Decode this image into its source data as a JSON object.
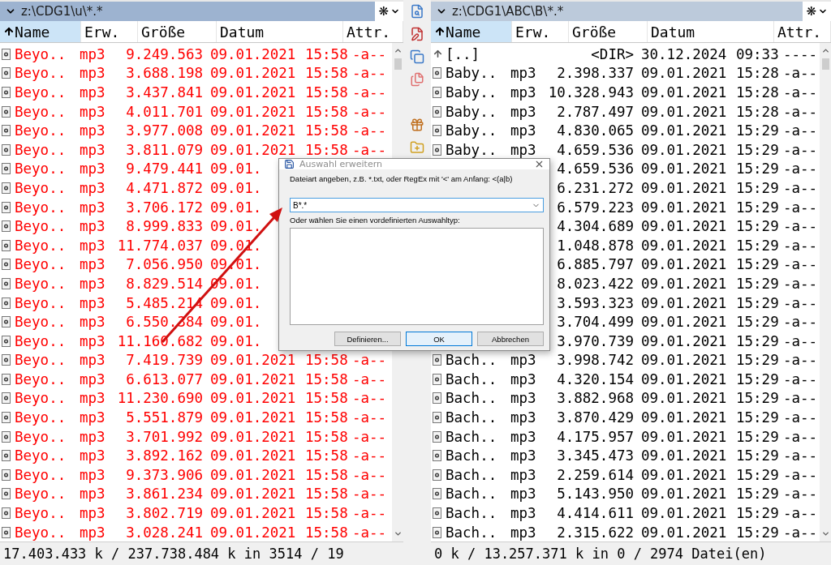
{
  "panels": [
    {
      "path": "z:\\CDG1\\u\\*.*",
      "active": true,
      "menu_glyph": "❋",
      "columns": [
        {
          "label": "Name",
          "selected": true
        },
        {
          "label": "Erw.",
          "selected": false
        },
        {
          "label": "Größe",
          "selected": false
        },
        {
          "label": "Datum",
          "selected": false
        },
        {
          "label": "Attr.",
          "selected": false
        }
      ],
      "rows": [
        {
          "kind": "file",
          "selected": true,
          "name": "Beyo..",
          "ext": "mp3",
          "size": "9.249.563",
          "date": "09.01.2021",
          "time": "15:58",
          "attr": "-a--"
        },
        {
          "kind": "file",
          "selected": true,
          "name": "Beyo..",
          "ext": "mp3",
          "size": "3.688.198",
          "date": "09.01.2021",
          "time": "15:58",
          "attr": "-a--"
        },
        {
          "kind": "file",
          "selected": true,
          "name": "Beyo..",
          "ext": "mp3",
          "size": "3.437.841",
          "date": "09.01.2021",
          "time": "15:58",
          "attr": "-a--"
        },
        {
          "kind": "file",
          "selected": true,
          "name": "Beyo..",
          "ext": "mp3",
          "size": "4.011.701",
          "date": "09.01.2021",
          "time": "15:58",
          "attr": "-a--"
        },
        {
          "kind": "file",
          "selected": true,
          "name": "Beyo..",
          "ext": "mp3",
          "size": "3.977.008",
          "date": "09.01.2021",
          "time": "15:58",
          "attr": "-a--"
        },
        {
          "kind": "file",
          "selected": true,
          "name": "Beyo..",
          "ext": "mp3",
          "size": "3.811.079",
          "date": "09.01.2021",
          "time": "15:58",
          "attr": "-a--"
        },
        {
          "kind": "file",
          "selected": true,
          "name": "Beyo..",
          "ext": "mp3",
          "size": "9.479.441",
          "date": "09.01."
        },
        {
          "kind": "file",
          "selected": true,
          "name": "Beyo..",
          "ext": "mp3",
          "size": "4.471.872",
          "date": "09.01."
        },
        {
          "kind": "file",
          "selected": true,
          "name": "Beyo..",
          "ext": "mp3",
          "size": "3.706.172",
          "date": "09.01."
        },
        {
          "kind": "file",
          "selected": true,
          "name": "Beyo..",
          "ext": "mp3",
          "size": "8.999.833",
          "date": "09.01."
        },
        {
          "kind": "file",
          "selected": true,
          "name": "Beyo..",
          "ext": "mp3",
          "size": "11.774.037",
          "date": "09.01."
        },
        {
          "kind": "file",
          "selected": true,
          "name": "Beyo..",
          "ext": "mp3",
          "size": "7.056.950",
          "date": "09.01."
        },
        {
          "kind": "file",
          "selected": true,
          "name": "Beyo..",
          "ext": "mp3",
          "size": "8.829.514",
          "date": "09.01."
        },
        {
          "kind": "file",
          "selected": true,
          "name": "Beyo..",
          "ext": "mp3",
          "size": "5.485.214",
          "date": "09.01."
        },
        {
          "kind": "file",
          "selected": true,
          "name": "Beyo..",
          "ext": "mp3",
          "size": "6.550.384",
          "date": "09.01."
        },
        {
          "kind": "file",
          "selected": true,
          "name": "Beyo..",
          "ext": "mp3",
          "size": "11.160.682",
          "date": "09.01."
        },
        {
          "kind": "file",
          "selected": true,
          "name": "Beyo..",
          "ext": "mp3",
          "size": "7.419.739",
          "date": "09.01.2021",
          "time": "15:58",
          "attr": "-a--"
        },
        {
          "kind": "file",
          "selected": true,
          "name": "Beyo..",
          "ext": "mp3",
          "size": "6.613.077",
          "date": "09.01.2021",
          "time": "15:58",
          "attr": "-a--"
        },
        {
          "kind": "file",
          "selected": true,
          "name": "Beyo..",
          "ext": "mp3",
          "size": "11.230.690",
          "date": "09.01.2021",
          "time": "15:58",
          "attr": "-a--"
        },
        {
          "kind": "file",
          "selected": true,
          "name": "Beyo..",
          "ext": "mp3",
          "size": "5.551.879",
          "date": "09.01.2021",
          "time": "15:58",
          "attr": "-a--"
        },
        {
          "kind": "file",
          "selected": true,
          "name": "Beyo..",
          "ext": "mp3",
          "size": "3.701.992",
          "date": "09.01.2021",
          "time": "15:58",
          "attr": "-a--"
        },
        {
          "kind": "file",
          "selected": true,
          "name": "Beyo..",
          "ext": "mp3",
          "size": "3.892.162",
          "date": "09.01.2021",
          "time": "15:58",
          "attr": "-a--"
        },
        {
          "kind": "file",
          "selected": true,
          "name": "Beyo..",
          "ext": "mp3",
          "size": "9.373.906",
          "date": "09.01.2021",
          "time": "15:58",
          "attr": "-a--"
        },
        {
          "kind": "file",
          "selected": true,
          "name": "Beyo..",
          "ext": "mp3",
          "size": "3.861.234",
          "date": "09.01.2021",
          "time": "15:58",
          "attr": "-a--"
        },
        {
          "kind": "file",
          "selected": true,
          "name": "Beyo..",
          "ext": "mp3",
          "size": "3.802.719",
          "date": "09.01.2021",
          "time": "15:58",
          "attr": "-a--"
        },
        {
          "kind": "file",
          "selected": true,
          "name": "Beyo..",
          "ext": "mp3",
          "size": "3.028.241",
          "date": "09.01.2021",
          "time": "15:58",
          "attr": "-a--"
        }
      ],
      "status": "17.403.433 k / 237.738.484 k in 3514 / 19"
    },
    {
      "path": "z:\\CDG1\\ABC\\B\\*.*",
      "active": false,
      "menu_glyph": "❋",
      "columns": [
        {
          "label": "Name",
          "selected": true
        },
        {
          "label": "Erw.",
          "selected": false
        },
        {
          "label": "Größe",
          "selected": false
        },
        {
          "label": "Datum",
          "selected": false
        },
        {
          "label": "Attr.",
          "selected": false
        }
      ],
      "rows": [
        {
          "kind": "parent",
          "selected": false,
          "name": "[..]",
          "size": "<DIR>",
          "date": "30.12.2024",
          "time": "09:33",
          "attr": "----"
        },
        {
          "kind": "file",
          "selected": false,
          "name": "Baby..",
          "ext": "mp3",
          "size": "2.398.337",
          "date": "09.01.2021",
          "time": "15:28",
          "attr": "-a--"
        },
        {
          "kind": "file",
          "selected": false,
          "name": "Baby..",
          "ext": "mp3",
          "size": "10.328.943",
          "date": "09.01.2021",
          "time": "15:28",
          "attr": "-a--"
        },
        {
          "kind": "file",
          "selected": false,
          "name": "Baby..",
          "ext": "mp3",
          "size": "2.787.497",
          "date": "09.01.2021",
          "time": "15:28",
          "attr": "-a--"
        },
        {
          "kind": "file",
          "selected": false,
          "name": "Baby..",
          "ext": "mp3",
          "size": "4.830.065",
          "date": "09.01.2021",
          "time": "15:29",
          "attr": "-a--"
        },
        {
          "kind": "file",
          "selected": false,
          "name": "Baby..",
          "ext": "mp3",
          "size": "4.659.536",
          "date": "09.01.2021",
          "time": "15:29",
          "attr": "-a--"
        },
        {
          "selected": false,
          "size": "4.659.536",
          "date": "09.01.2021",
          "time": "15:29",
          "attr": "-a--"
        },
        {
          "selected": false,
          "size": "6.231.272",
          "date": "09.01.2021",
          "time": "15:29",
          "attr": "-a--"
        },
        {
          "selected": false,
          "size": "6.579.223",
          "date": "09.01.2021",
          "time": "15:29",
          "attr": "-a--"
        },
        {
          "selected": false,
          "size": "4.304.689",
          "date": "09.01.2021",
          "time": "15:29",
          "attr": "-a--"
        },
        {
          "selected": false,
          "size": "1.048.878",
          "date": "09.01.2021",
          "time": "15:29",
          "attr": "-a--"
        },
        {
          "selected": false,
          "size": "6.885.797",
          "date": "09.01.2021",
          "time": "15:29",
          "attr": "-a--"
        },
        {
          "selected": false,
          "size": "8.023.422",
          "date": "09.01.2021",
          "time": "15:29",
          "attr": "-a--"
        },
        {
          "selected": false,
          "size": "3.593.323",
          "date": "09.01.2021",
          "time": "15:29",
          "attr": "-a--"
        },
        {
          "selected": false,
          "size": "3.704.499",
          "date": "09.01.2021",
          "time": "15:29",
          "attr": "-a--"
        },
        {
          "selected": false,
          "size": "3.970.739",
          "date": "09.01.2021",
          "time": "15:29",
          "attr": "-a--"
        },
        {
          "kind": "file",
          "selected": false,
          "name": "Bach..",
          "ext": "mp3",
          "size": "3.998.742",
          "date": "09.01.2021",
          "time": "15:29",
          "attr": "-a--"
        },
        {
          "kind": "file",
          "selected": false,
          "name": "Bach..",
          "ext": "mp3",
          "size": "4.320.154",
          "date": "09.01.2021",
          "time": "15:29",
          "attr": "-a--"
        },
        {
          "kind": "file",
          "selected": false,
          "name": "Bach..",
          "ext": "mp3",
          "size": "3.882.968",
          "date": "09.01.2021",
          "time": "15:29",
          "attr": "-a--"
        },
        {
          "kind": "file",
          "selected": false,
          "name": "Bach..",
          "ext": "mp3",
          "size": "3.870.429",
          "date": "09.01.2021",
          "time": "15:29",
          "attr": "-a--"
        },
        {
          "kind": "file",
          "selected": false,
          "name": "Bach..",
          "ext": "mp3",
          "size": "4.175.957",
          "date": "09.01.2021",
          "time": "15:29",
          "attr": "-a--"
        },
        {
          "kind": "file",
          "selected": false,
          "name": "Bach..",
          "ext": "mp3",
          "size": "3.345.473",
          "date": "09.01.2021",
          "time": "15:29",
          "attr": "-a--"
        },
        {
          "kind": "file",
          "selected": false,
          "name": "Bach..",
          "ext": "mp3",
          "size": "2.259.614",
          "date": "09.01.2021",
          "time": "15:29",
          "attr": "-a--"
        },
        {
          "kind": "file",
          "selected": false,
          "name": "Bach..",
          "ext": "mp3",
          "size": "5.143.950",
          "date": "09.01.2021",
          "time": "15:29",
          "attr": "-a--"
        },
        {
          "kind": "file",
          "selected": false,
          "name": "Bach..",
          "ext": "mp3",
          "size": "4.414.611",
          "date": "09.01.2021",
          "time": "15:29",
          "attr": "-a--"
        },
        {
          "kind": "file",
          "selected": false,
          "name": "Bach..",
          "ext": "mp3",
          "size": "2.315.622",
          "date": "09.01.2021",
          "time": "15:29",
          "attr": "-a--"
        }
      ],
      "status": "0 k / 13.257.371 k in 0 / 2974 Datei(en)"
    }
  ],
  "dialog": {
    "title": "Auswahl erweitern",
    "prompt": "Dateiart angeben, z.B. *.txt, oder RegEx mit '<' am Anfang: <(a|b)",
    "value": "B*.*",
    "list_label": "Oder wählen Sie einen vordefinierten Auswahltyp:",
    "buttons": [
      {
        "label": "Definieren...",
        "default": false
      },
      {
        "label": "OK",
        "default": true
      },
      {
        "label": "Abbrechen",
        "default": false
      }
    ]
  }
}
